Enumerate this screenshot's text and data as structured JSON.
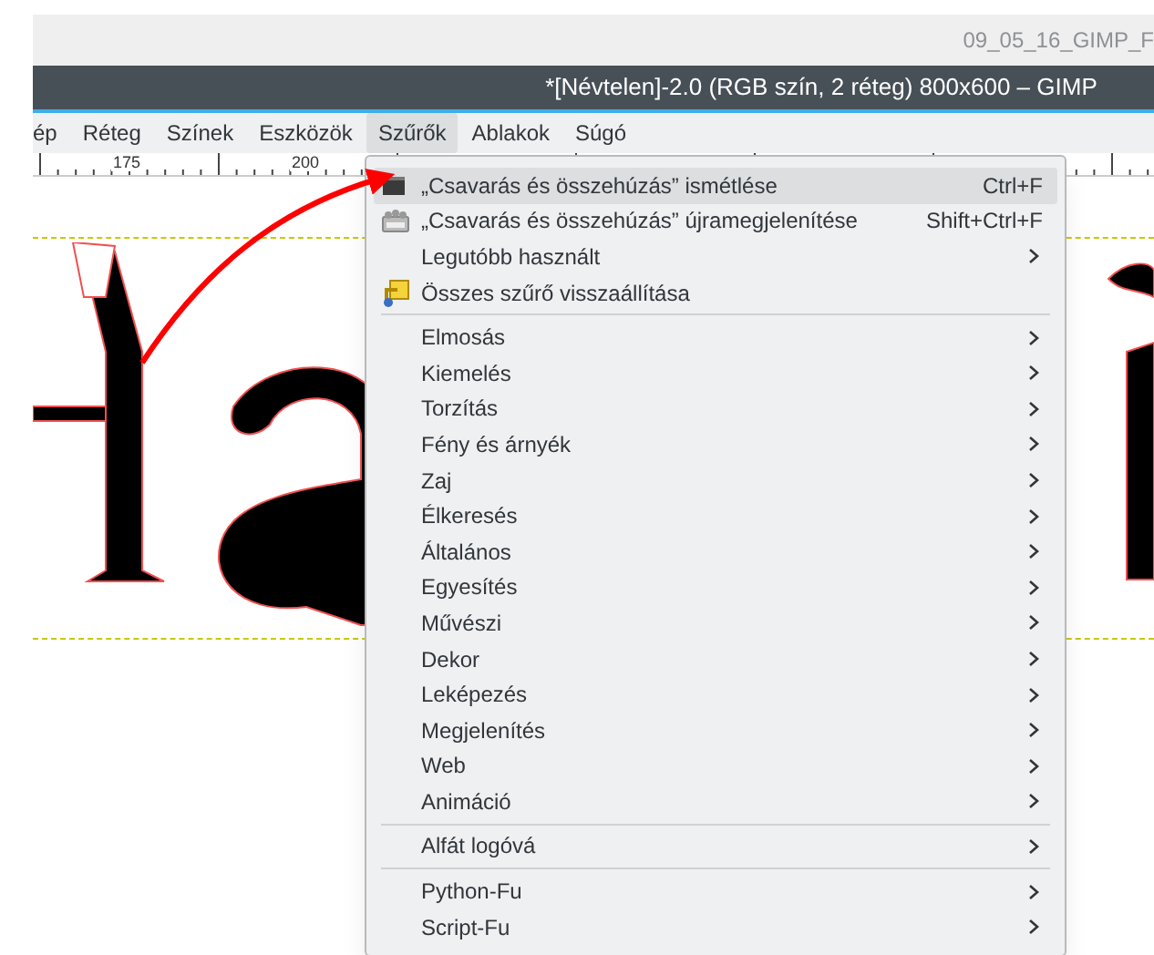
{
  "window": {
    "tab_title": "09_05_16_GIMP_F",
    "title": "*[Névtelen]-2.0 (RGB szín, 2 réteg) 800x600 – GIMP"
  },
  "menubar": [
    {
      "label": "ép",
      "selected": false
    },
    {
      "label": "Réteg",
      "selected": false
    },
    {
      "label": "Színek",
      "selected": false
    },
    {
      "label": "Eszközök",
      "selected": false
    },
    {
      "label": "Szűrők",
      "selected": true
    },
    {
      "label": "Ablakok",
      "selected": false
    },
    {
      "label": "Súgó",
      "selected": false
    }
  ],
  "ruler": {
    "labels": [
      "175",
      "200"
    ]
  },
  "menu": {
    "groups": [
      [
        {
          "label": "„Csavarás és összehúzás” ismétlése",
          "shortcut": "Ctrl+F",
          "submenu": false,
          "selected": true
        },
        {
          "label": "„Csavarás és összehúzás” újramegjelenítése",
          "shortcut": "Shift+Ctrl+F",
          "submenu": false,
          "selected": false
        },
        {
          "label": "Legutóbb használt",
          "submenu": true,
          "selected": false
        },
        {
          "label": "Összes szűrő visszaállítása",
          "submenu": false,
          "selected": false
        }
      ],
      [
        {
          "label": "Elmosás",
          "submenu": true,
          "selected": false
        },
        {
          "label": "Kiemelés",
          "submenu": true,
          "selected": false
        },
        {
          "label": "Torzítás",
          "submenu": true,
          "selected": false
        },
        {
          "label": "Fény és árnyék",
          "submenu": true,
          "selected": false
        },
        {
          "label": "Zaj",
          "submenu": true,
          "selected": false
        },
        {
          "label": "Élkeresés",
          "submenu": true,
          "selected": false
        },
        {
          "label": "Általános",
          "submenu": true,
          "selected": false
        },
        {
          "label": "Egyesítés",
          "submenu": true,
          "selected": false
        },
        {
          "label": "Művészi",
          "submenu": true,
          "selected": false
        },
        {
          "label": "Dekor",
          "submenu": true,
          "selected": false
        },
        {
          "label": "Leképezés",
          "submenu": true,
          "selected": false
        },
        {
          "label": "Megjelenítés",
          "submenu": true,
          "selected": false
        },
        {
          "label": "Web",
          "submenu": true,
          "selected": false
        },
        {
          "label": "Animáció",
          "submenu": true,
          "selected": false
        }
      ],
      [
        {
          "label": "Alfát logóvá",
          "submenu": true,
          "selected": false
        }
      ],
      [
        {
          "label": "Python-Fu",
          "submenu": true,
          "selected": false
        },
        {
          "label": "Script-Fu",
          "submenu": true,
          "selected": false
        }
      ]
    ]
  }
}
